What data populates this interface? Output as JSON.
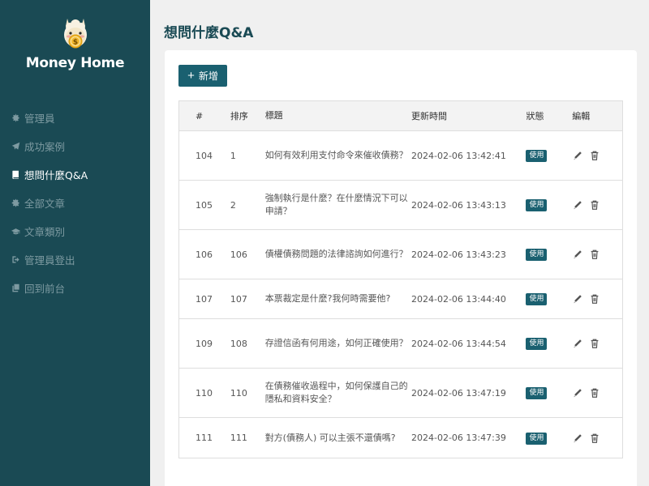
{
  "app": {
    "name": "Money Home"
  },
  "sidebar": {
    "items": [
      {
        "label": "管理員",
        "icon": "gear-icon",
        "active": false
      },
      {
        "label": "成功案例",
        "icon": "paper-plane-icon",
        "active": false
      },
      {
        "label": "想問什麼Q&A",
        "icon": "book-icon",
        "active": true
      },
      {
        "label": "全部文章",
        "icon": "cog-icon",
        "active": false
      },
      {
        "label": "文章類別",
        "icon": "graduation-cap-icon",
        "active": false
      },
      {
        "label": "管理員登出",
        "icon": "sign-out-icon",
        "active": false
      },
      {
        "label": "回到前台",
        "icon": "copy-icon",
        "active": false
      }
    ]
  },
  "page": {
    "title": "想問什麼Q&A"
  },
  "toolbar": {
    "add_label": "新增"
  },
  "table": {
    "headers": {
      "id": "#",
      "sort": "排序",
      "title": "標題",
      "updated": "更新時間",
      "status": "狀態",
      "edit": "編輯"
    },
    "rows": [
      {
        "id": "104",
        "sort": "1",
        "title": "如何有效利用支付命令來催收債務？",
        "updated": "2024-02-06 13:42:41",
        "status": "使用"
      },
      {
        "id": "105",
        "sort": "2",
        "title": "強制執行是什麼？在什麼情況下可以申請？",
        "updated": "2024-02-06 13:43:13",
        "status": "使用"
      },
      {
        "id": "106",
        "sort": "106",
        "title": "債權債務問題的法律諮詢如何進行？",
        "updated": "2024-02-06 13:43:23",
        "status": "使用"
      },
      {
        "id": "107",
        "sort": "107",
        "title": "本票裁定是什麼?我何時需要他?",
        "updated": "2024-02-06 13:44:40",
        "status": "使用"
      },
      {
        "id": "109",
        "sort": "108",
        "title": "存證信函有何用途，如何正確使用？",
        "updated": "2024-02-06 13:44:54",
        "status": "使用"
      },
      {
        "id": "110",
        "sort": "110",
        "title": "在債務催收過程中，如何保護自己的隱私和資料安全？",
        "updated": "2024-02-06 13:47:19",
        "status": "使用"
      },
      {
        "id": "111",
        "sort": "111",
        "title": "對方(債務人) 可以主張不還債嗎?",
        "updated": "2024-02-06 13:47:39",
        "status": "使用"
      }
    ]
  },
  "colors": {
    "sidebar_bg": "#1a4a54",
    "accent": "#1a6070",
    "page_bg": "#f0f0f0"
  }
}
